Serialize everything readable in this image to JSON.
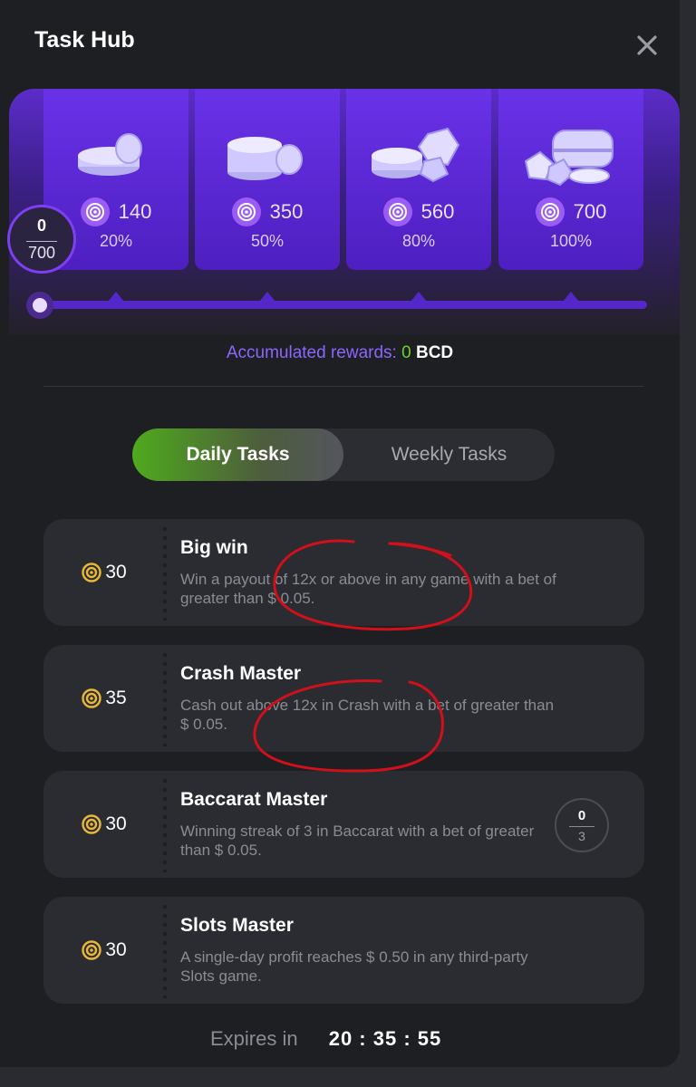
{
  "header": {
    "title": "Task Hub"
  },
  "progress": {
    "current": "0",
    "total": "700"
  },
  "reward_tiers": [
    {
      "points": "140",
      "percent": "20%"
    },
    {
      "points": "350",
      "percent": "50%"
    },
    {
      "points": "560",
      "percent": "80%"
    },
    {
      "points": "700",
      "percent": "100%"
    }
  ],
  "accumulated": {
    "label": "Accumulated rewards:",
    "value": "0",
    "currency": "BCD"
  },
  "tabs": {
    "daily": "Daily Tasks",
    "weekly": "Weekly Tasks",
    "active": "daily"
  },
  "tasks": [
    {
      "reward": "30",
      "title": "Big win",
      "description": "Win a payout of 12x or above in any game with a bet of greater than $ 0.05."
    },
    {
      "reward": "35",
      "title": "Crash Master",
      "description": "Cash out above 12x in Crash with a bet of greater than $ 0.05."
    },
    {
      "reward": "30",
      "title": "Baccarat Master",
      "description": "Winning streak of 3 in Baccarat with a bet of greater than $ 0.05.",
      "progress_current": "0",
      "progress_total": "3"
    },
    {
      "reward": "30",
      "title": "Slots Master",
      "description": "A single-day profit reaches $ 0.50 in any third-party Slots game."
    }
  ],
  "expires": {
    "label": "Expires in",
    "time": "20 : 35 : 55"
  },
  "colors": {
    "accent_purple": "#5428c8",
    "accent_green": "#6cd12b",
    "annotation_red": "#d0101a",
    "coin_gold": "#e8b83a"
  }
}
